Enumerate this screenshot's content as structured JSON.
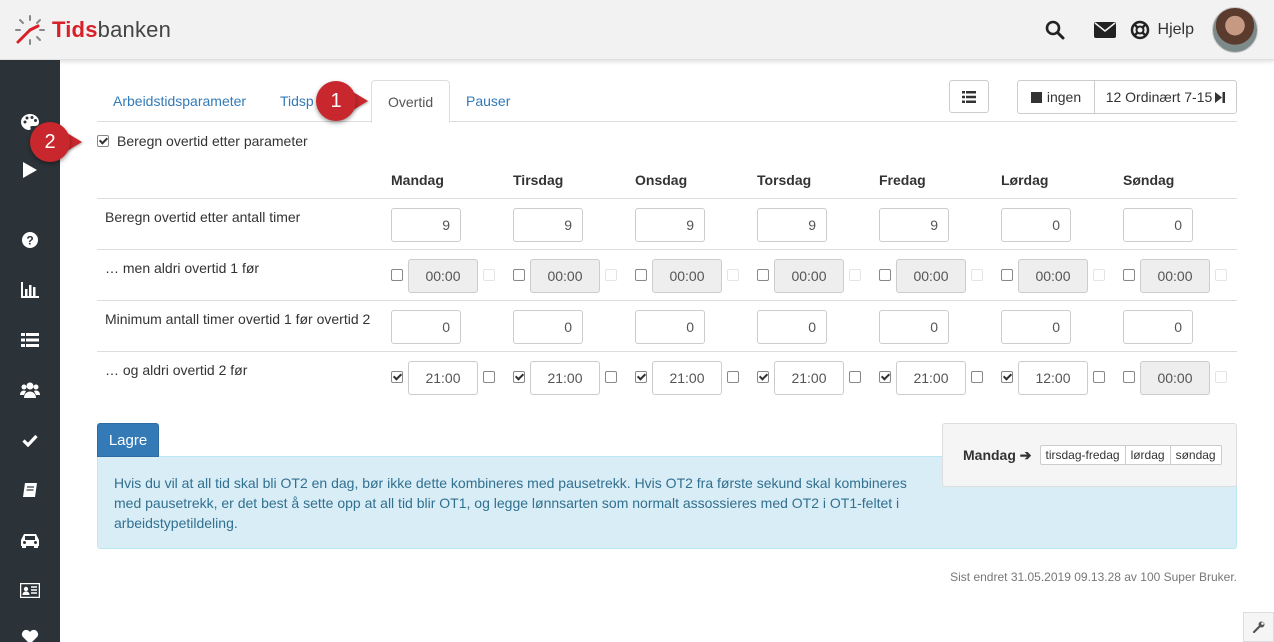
{
  "brand": {
    "name_bold": "Tids",
    "name_rest": "banken"
  },
  "topbar": {
    "help_label": "Hjelp"
  },
  "tabs": [
    {
      "label": "Arbeidstidsparameter"
    },
    {
      "label": "Tidsp"
    },
    {
      "label": "Overtid"
    },
    {
      "label": "Pauser"
    }
  ],
  "toolbar": {
    "range_start": "ingen",
    "range_end": "12 Ordinært 7-15"
  },
  "markers": {
    "m1": "1",
    "m2": "2"
  },
  "checkbox_main": {
    "label": "Beregn overtid etter parameter",
    "checked": true
  },
  "days": [
    "Mandag",
    "Tirsdag",
    "Onsdag",
    "Torsdag",
    "Fredag",
    "Lørdag",
    "Søndag"
  ],
  "rows": [
    {
      "label": "Beregn overtid etter antall timer",
      "values": [
        "9",
        "9",
        "9",
        "9",
        "9",
        "0",
        "0"
      ]
    },
    {
      "label": "… men aldri overtid 1 før",
      "values": [
        "00:00",
        "00:00",
        "00:00",
        "00:00",
        "00:00",
        "00:00",
        "00:00"
      ]
    },
    {
      "label": "Minimum antall timer overtid 1 før overtid 2",
      "values": [
        "0",
        "0",
        "0",
        "0",
        "0",
        "0",
        "0"
      ]
    },
    {
      "label": "… og aldri overtid 2 før",
      "values": [
        "21:00",
        "21:00",
        "21:00",
        "21:00",
        "21:00",
        "12:00",
        "00:00"
      ]
    }
  ],
  "save_label": "Lagre",
  "info_text": "Hvis du vil at all tid skal bli OT2 en dag, bør ikke dette kombineres med pausetrekk. Hvis OT2 fra første sekund skal kombineres med pausetrekk, er det best å sette opp at all tid blir OT1, og legge lønnsarten som normalt assossieres med OT2 i OT1-feltet i arbeidstypetildeling.",
  "legend": {
    "main": "Mandag ➔",
    "chips": [
      "tirsdag-fredag",
      "lørdag",
      "søndag"
    ]
  },
  "footer": "Sist endret 31.05.2019 09.13.28 av 100 Super Bruker.",
  "colors": {
    "brand_red": "#d92028",
    "link": "#337ab7",
    "sidebar": "#2c3338",
    "info_bg": "#d9edf7",
    "marker": "#c8282d"
  }
}
